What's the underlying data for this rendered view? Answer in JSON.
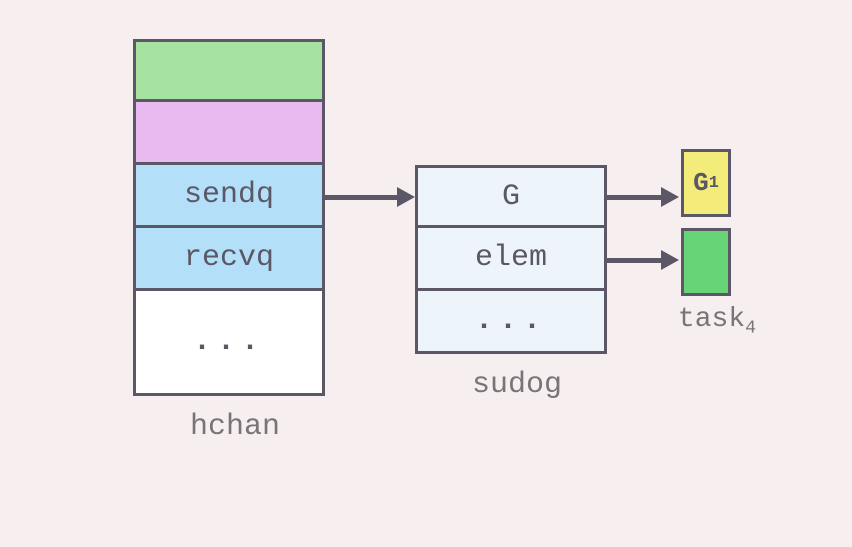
{
  "hchan": {
    "sendq": "sendq",
    "recvq": "recvq",
    "ellipsis": "...",
    "label": "hchan"
  },
  "sudog": {
    "g": "G",
    "elem": "elem",
    "ellipsis": "...",
    "label": "sudog"
  },
  "right": {
    "g_prefix": "G",
    "g_sub": "1",
    "task_prefix": "task",
    "task_sub": "4"
  },
  "colors": {
    "border": "#5b5766",
    "bg": "#f7eef0",
    "green": "#a6e3a1",
    "pink": "#e8baf0",
    "blue": "#b3dff8",
    "lightblue": "#edf4fa",
    "yellow": "#f4ec7a",
    "brightgreen": "#67d377"
  }
}
